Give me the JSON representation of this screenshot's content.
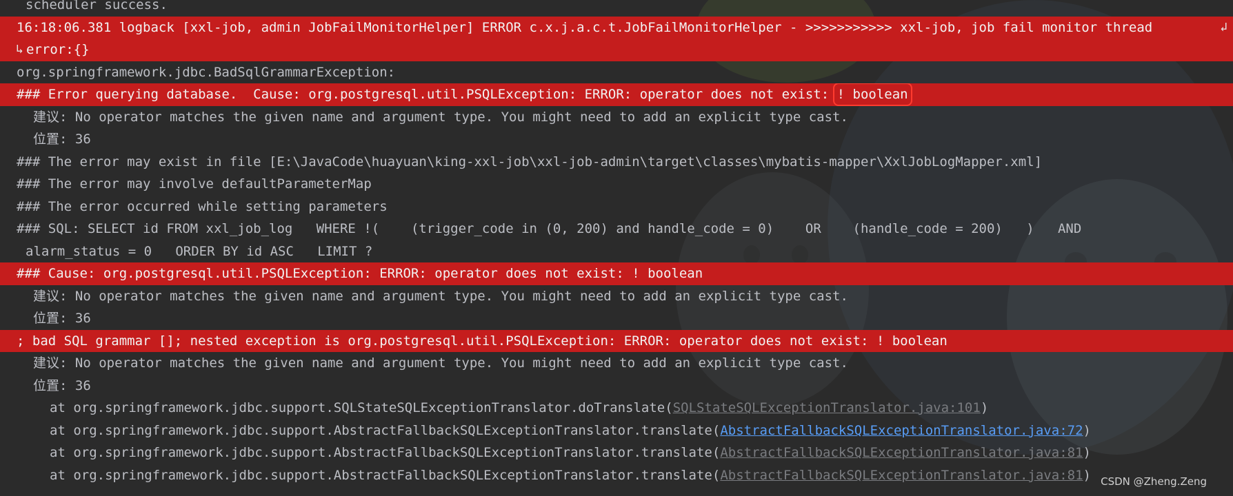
{
  "console": {
    "line_01": "scheduler success.",
    "line_02": "16:18:06.381 logback [xxl-job, admin JobFailMonitorHelper] ERROR c.x.j.a.c.t.JobFailMonitorHelper - >>>>>>>>>>> xxl-job, job fail monitor thread",
    "line_03": "error:{}",
    "line_04": "org.springframework.jdbc.BadSqlGrammarException:",
    "line_05_pre": "### Error querying database.  Cause: org.postgresql.util.PSQLException: ERROR: operator does not exist: ",
    "line_05_boxed": "! boolean",
    "line_06": "建议: No operator matches the given name and argument type. You might need to add an explicit type cast.",
    "line_07": "位置: 36",
    "line_08": "### The error may exist in file [E:\\JavaCode\\huayuan\\king-xxl-job\\xxl-job-admin\\target\\classes\\mybatis-mapper\\XxlJobLogMapper.xml]",
    "line_09": "### The error may involve defaultParameterMap",
    "line_10": "### The error occurred while setting parameters",
    "line_11": "### SQL: SELECT id FROM xxl_job_log   WHERE !(    (trigger_code in (0, 200) and handle_code = 0)    OR    (handle_code = 200)   )   AND",
    "line_12": "alarm_status = 0   ORDER BY id ASC   LIMIT ?",
    "line_13": "### Cause: org.postgresql.util.PSQLException: ERROR: operator does not exist: ! boolean",
    "line_14": "建议: No operator matches the given name and argument type. You might need to add an explicit type cast.",
    "line_15": "位置: 36",
    "line_16": "; bad SQL grammar []; nested exception is org.postgresql.util.PSQLException: ERROR: operator does not exist: ! boolean",
    "line_17": "建议: No operator matches the given name and argument type. You might need to add an explicit type cast.",
    "line_18": "位置: 36",
    "trace": [
      {
        "prefix": "at org.springframework.jdbc.support.SQLStateSQLExceptionTranslator.doTranslate(",
        "link": "SQLStateSQLExceptionTranslator.java:101",
        "suffix": ")"
      },
      {
        "prefix": "at org.springframework.jdbc.support.AbstractFallbackSQLExceptionTranslator.translate(",
        "link": "AbstractFallbackSQLExceptionTranslator.java:72",
        "suffix": ")"
      },
      {
        "prefix": "at org.springframework.jdbc.support.AbstractFallbackSQLExceptionTranslator.translate(",
        "link": "AbstractFallbackSQLExceptionTranslator.java:81",
        "suffix": ")"
      },
      {
        "prefix": "at org.springframework.jdbc.support.AbstractFallbackSQLExceptionTranslator.translate(",
        "link": "AbstractFallbackSQLExceptionTranslator.java:81",
        "suffix": ")"
      }
    ]
  },
  "watermark": "CSDN @Zheng.Zeng",
  "icons": {
    "soft_wrap": "soft-wrap-icon"
  },
  "colors": {
    "background": "#2b2b2b",
    "error_bg": "#c51d1d",
    "link_blue": "#589df6",
    "box": "#ff3b2f"
  }
}
